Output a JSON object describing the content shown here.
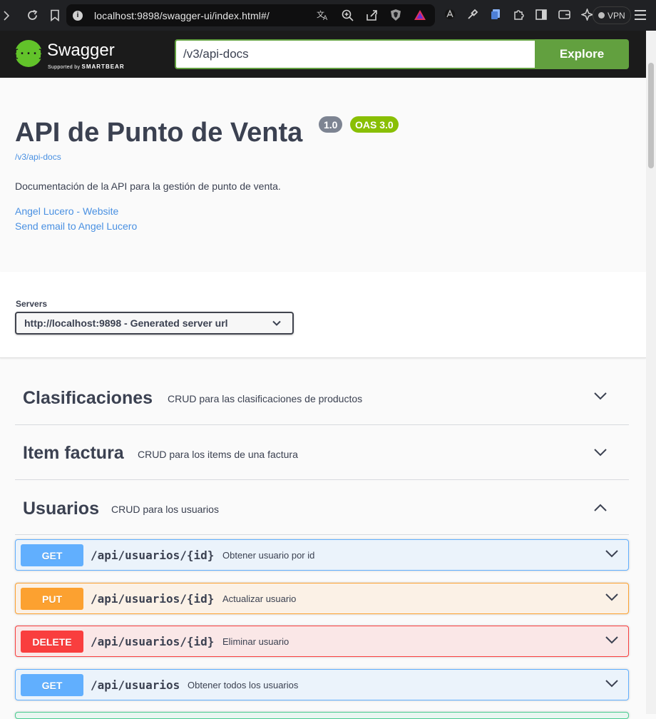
{
  "browser": {
    "url": "localhost:9898/swagger-ui/index.html#/",
    "vpn_label": "VPN"
  },
  "topbar": {
    "logo_text": "Swagger",
    "logo_sub_prefix": "Supported by",
    "logo_sub_brand": "SMARTBEAR",
    "search_value": "/v3/api-docs",
    "explore_label": "Explore"
  },
  "info": {
    "title": "API de Punto de Venta",
    "version": "1.0",
    "oas": "OAS 3.0",
    "spec_url": "/v3/api-docs",
    "description": "Documentación de la API para la gestión de punto de venta.",
    "contact_website": "Angel Lucero - Website",
    "contact_email": "Send email to Angel Lucero"
  },
  "servers": {
    "label": "Servers",
    "selected": "http://localhost:9898 - Generated server url"
  },
  "tags": [
    {
      "name": "Clasificaciones",
      "description": "CRUD para las clasificaciones de productos",
      "expanded": false
    },
    {
      "name": "Item factura",
      "description": "CRUD para los items de una factura",
      "expanded": false
    },
    {
      "name": "Usuarios",
      "description": "CRUD para los usuarios",
      "expanded": true
    }
  ],
  "operations": [
    {
      "method": "GET",
      "path": "/api/usuarios/{id}",
      "summary": "Obtener usuario por id"
    },
    {
      "method": "PUT",
      "path": "/api/usuarios/{id}",
      "summary": "Actualizar usuario"
    },
    {
      "method": "DELETE",
      "path": "/api/usuarios/{id}",
      "summary": "Eliminar usuario"
    },
    {
      "method": "GET",
      "path": "/api/usuarios",
      "summary": "Obtener todos los usuarios"
    }
  ],
  "colors": {
    "get": "#61affe",
    "put": "#fca130",
    "delete": "#f93e3e",
    "post": "#49cc90",
    "swagger_green": "#62a03f"
  }
}
